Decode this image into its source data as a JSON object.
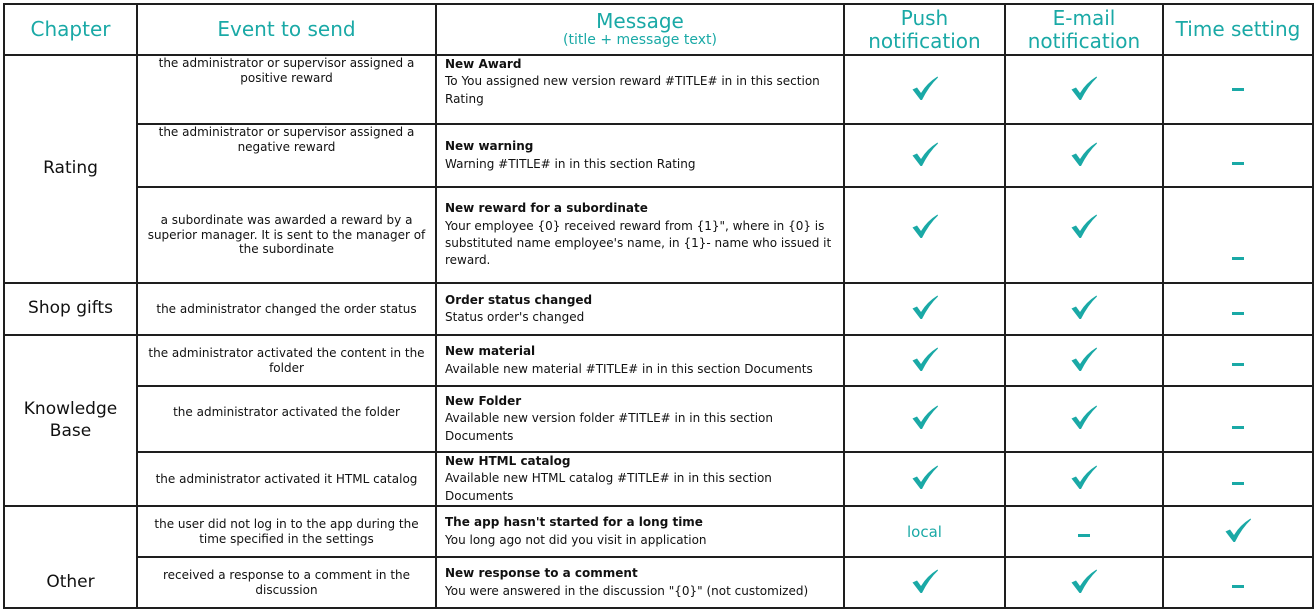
{
  "colors": {
    "accent": "#1aa9a6",
    "border": "#1e1e1e",
    "text": "#111111"
  },
  "header": {
    "chapter": "Chapter",
    "event": "Event to send",
    "message": "Message",
    "message_sub": "(title + message text)",
    "push_1": "Push",
    "push_2": "notification",
    "email_1": "E-mail",
    "email_2": "notification",
    "time": "Time setting"
  },
  "chapters": {
    "rating": "Rating",
    "shop": "Shop gifts",
    "kb_1": "Knowledge",
    "kb_2": "Base",
    "other": "Other"
  },
  "rows": [
    {
      "event": "the administrator or supervisor assigned a positive reward",
      "title": "New Award",
      "body": "To You assigned new version reward #TITLE# in in this section Rating",
      "push": "check",
      "email": "check",
      "time": "dash"
    },
    {
      "event": "the administrator or supervisor assigned a negative reward",
      "title": "New warning",
      "body": "Warning #TITLE# in in this section Rating",
      "push": "check",
      "email": "check",
      "time": "dash"
    },
    {
      "event": "a subordinate was awarded a reward by a superior manager. It is sent to the manager of the subordinate",
      "title": "New reward for a subordinate",
      "body": "Your employee {0} received reward from {1}\", where in {0} is substituted name employee's name, in {1}- name who issued it reward.",
      "push": "check",
      "email": "check",
      "time": "dash"
    },
    {
      "event": "the administrator changed the order status",
      "title": "Order status changed",
      "body": "Status order's changed",
      "push": "check",
      "email": "check",
      "time": "dash"
    },
    {
      "event": "the administrator activated the content in the folder",
      "title": "New material",
      "body": "Available new material #TITLE# in in this section Documents",
      "push": "check",
      "email": "check",
      "time": "dash"
    },
    {
      "event": "the administrator activated the folder",
      "title": "New Folder",
      "body": "Available new version folder #TITLE# in in this section Documents",
      "push": "check",
      "email": "check",
      "time": "dash"
    },
    {
      "event": "the administrator activated it HTML catalog",
      "title": "New HTML catalog",
      "body": "Available new HTML catalog #TITLE# in in this section Documents",
      "push": "check",
      "email": "check",
      "time": "dash"
    },
    {
      "event": "the user did not log in to the app during the time specified in the settings",
      "title": "The app hasn't started for a long time",
      "body": "You long ago not did you visit in application",
      "push": "local",
      "email": "dash",
      "time": "check"
    },
    {
      "event": "received a response to a comment in the discussion",
      "title": "New response to a comment",
      "body": "You were answered in the discussion \"{0}\" (not customized)",
      "push": "check",
      "email": "check",
      "time": "dash"
    }
  ],
  "labels": {
    "local": "local"
  },
  "icons": {
    "check": "check-icon",
    "dash": "dash-icon"
  }
}
